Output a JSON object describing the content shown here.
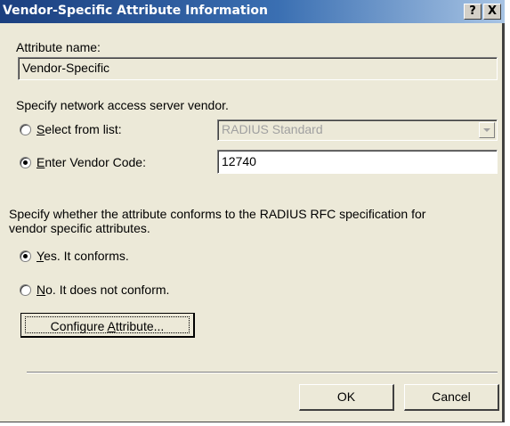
{
  "window": {
    "title": "Vendor-Specific Attribute Information",
    "help_button": "?",
    "close_button": "X"
  },
  "attribute": {
    "label": "Attribute name:",
    "value": "Vendor-Specific"
  },
  "vendor": {
    "heading": "Specify network access server vendor.",
    "select_from_list": {
      "label_mnemonic": "S",
      "label_rest": "elect from list:",
      "selected": false
    },
    "vendor_dropdown": {
      "value": "RADIUS Standard",
      "disabled": true
    },
    "enter_vendor_code": {
      "label_mnemonic": "E",
      "label_rest": "nter Vendor Code:",
      "selected": true
    },
    "vendor_code": "12740"
  },
  "conformance": {
    "heading_line1": "Specify whether the attribute conforms to the RADIUS RFC specification for",
    "heading_line2": "vendor specific attributes.",
    "yes": {
      "mnemonic": "Y",
      "rest": "es. It conforms.",
      "selected": true
    },
    "no": {
      "mnemonic": "N",
      "rest": "o. It does not conform.",
      "selected": false
    }
  },
  "configure_button": {
    "prefix": "Configure ",
    "mnemonic": "A",
    "rest": "ttribute..."
  },
  "footer": {
    "ok": "OK",
    "cancel": "Cancel"
  }
}
